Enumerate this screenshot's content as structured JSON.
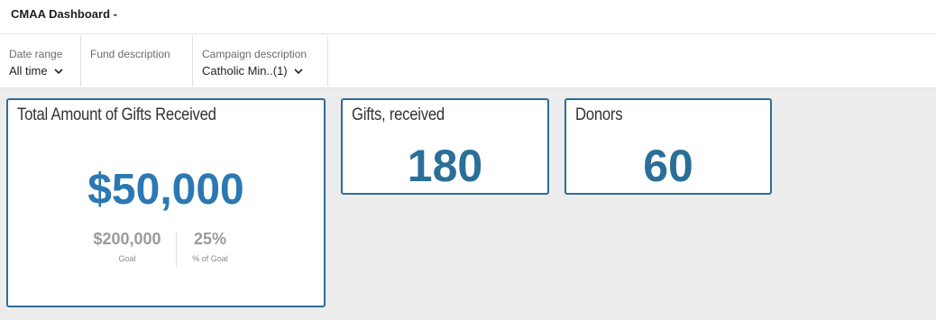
{
  "header": {
    "title": "CMAA Dashboard -"
  },
  "filters": [
    {
      "label": "Date range",
      "value": "All time"
    },
    {
      "label": "Fund description",
      "value": ""
    },
    {
      "label": "Campaign description",
      "value": "Catholic Min..(1)"
    }
  ],
  "cards": {
    "total_gifts": {
      "title": "Total Amount of Gifts Received",
      "value": "$50,000",
      "goal_value": "$200,000",
      "goal_caption": "Goal",
      "pct_value": "25%",
      "pct_caption": "% of Goal"
    },
    "gifts_received": {
      "title": "Gifts, received",
      "value": "180"
    },
    "donors": {
      "title": "Donors",
      "value": "60"
    }
  },
  "colors": {
    "accent": "#2e6d96",
    "kpi": "#2b78b3",
    "canvas": "#ececec"
  },
  "icons": {
    "dropdown": "chevron-down-icon"
  }
}
